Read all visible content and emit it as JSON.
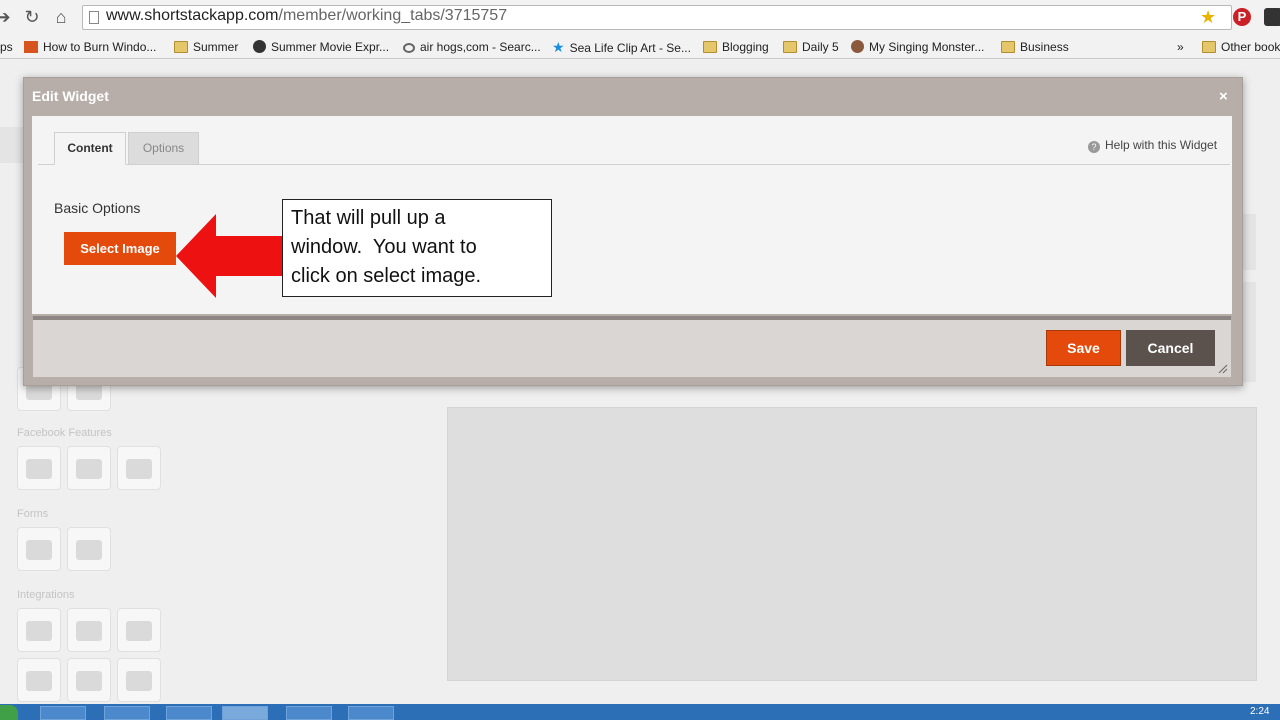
{
  "browser": {
    "url_domain": "www.shortstackapp.com",
    "url_path": "/member/working_tabs/3715757",
    "bookmarks": [
      {
        "label": "ps",
        "icon": "none"
      },
      {
        "label": "How to Burn Windo...",
        "icon": "site-favicon"
      },
      {
        "label": "Summer",
        "icon": "folder-icon"
      },
      {
        "label": "Summer Movie Expr...",
        "icon": "site-favicon"
      },
      {
        "label": "air hogs,com - Searc...",
        "icon": "search-icon"
      },
      {
        "label": "Sea Life Clip Art - Se...",
        "icon": "star-favicon"
      },
      {
        "label": "Blogging",
        "icon": "folder-icon"
      },
      {
        "label": "Daily 5",
        "icon": "folder-icon"
      },
      {
        "label": "My Singing Monster...",
        "icon": "site-favicon"
      },
      {
        "label": "Business",
        "icon": "folder-icon"
      }
    ],
    "overflow": "»",
    "other_bookmarks": "Other bookmarks"
  },
  "background": {
    "sections": [
      "Facebook Features",
      "Forms",
      "Integrations"
    ]
  },
  "modal": {
    "title": "Edit Widget",
    "close": "×",
    "tabs": [
      {
        "label": "Content",
        "active": true
      },
      {
        "label": "Options",
        "active": false
      }
    ],
    "help": "Help with this Widget",
    "section_label": "Basic Options",
    "select_image": "Select Image",
    "save": "Save",
    "cancel": "Cancel"
  },
  "annotation": {
    "line1": "That will pull up a",
    "line2": "window.  You want to",
    "line3": "click on select image."
  },
  "taskbar": {
    "clock": "2:24"
  },
  "colors": {
    "accent_orange": "#e44a0c",
    "cancel_gray": "#5b524e",
    "modal_header": "#b7aea9",
    "arrow_red": "#ee1111"
  }
}
